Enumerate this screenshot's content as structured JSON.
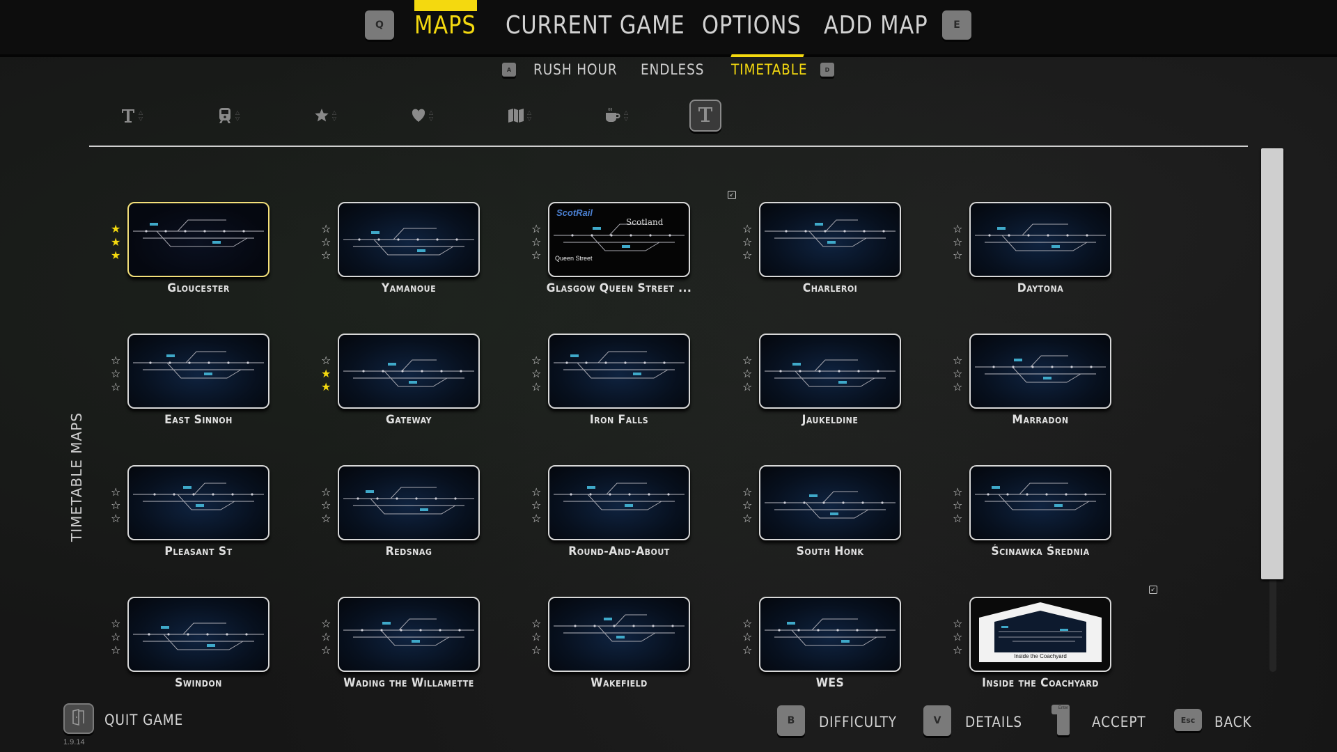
{
  "header": {
    "prev_key": "Q",
    "next_key": "E",
    "tabs": [
      {
        "label": "MAPS",
        "active": true
      },
      {
        "label": "CURRENT GAME",
        "active": false
      },
      {
        "label": "OPTIONS",
        "active": false
      },
      {
        "label": "ADD MAP",
        "active": false
      }
    ]
  },
  "subtabs": {
    "prev_key": "A",
    "next_key": "D",
    "items": [
      {
        "label": "RUSH HOUR",
        "active": false
      },
      {
        "label": "ENDLESS",
        "active": false
      },
      {
        "label": "TIMETABLE",
        "active": true
      }
    ]
  },
  "filters": [
    {
      "icon": "text-sort-icon",
      "label": "Name"
    },
    {
      "icon": "train-icon",
      "label": "Trains"
    },
    {
      "icon": "star-icon",
      "label": "Stars"
    },
    {
      "icon": "heart-icon",
      "label": "Favourites"
    },
    {
      "icon": "map-icon",
      "label": "Map"
    },
    {
      "icon": "coffee-icon",
      "label": "Casual"
    },
    {
      "icon": "text-icon",
      "label": "Timetable",
      "selected": true
    }
  ],
  "section_label": "TIMETABLE MAPS",
  "maps": [
    {
      "name": "Gloucester",
      "stars": 3,
      "selected": true,
      "custom": false
    },
    {
      "name": "Yamanoue",
      "stars": 0,
      "custom": false
    },
    {
      "name": "Glasgow Queen Street ...",
      "stars": 0,
      "custom": true,
      "thumb_text": [
        "ScotRail",
        "Scotland",
        "Queen Street"
      ]
    },
    {
      "name": "Charleroi",
      "stars": 0,
      "custom": false
    },
    {
      "name": "Daytona",
      "stars": 0,
      "custom": false
    },
    {
      "name": "East Sinnoh",
      "stars": 0,
      "custom": false
    },
    {
      "name": "Gateway",
      "stars": 2,
      "custom": false
    },
    {
      "name": "Iron Falls",
      "stars": 0,
      "custom": false
    },
    {
      "name": "Jaukeldine",
      "stars": 0,
      "custom": false
    },
    {
      "name": "Marradon",
      "stars": 0,
      "custom": false
    },
    {
      "name": "Pleasant St",
      "stars": 0,
      "custom": false
    },
    {
      "name": "Redsnag",
      "stars": 0,
      "custom": false
    },
    {
      "name": "Round-And-About",
      "stars": 0,
      "custom": false
    },
    {
      "name": "South Honk",
      "stars": 0,
      "custom": false
    },
    {
      "name": "Ścinawka Średnia",
      "stars": 0,
      "custom": false
    },
    {
      "name": "Swindon",
      "stars": 0,
      "custom": false
    },
    {
      "name": "Wading the Willamette",
      "stars": 0,
      "custom": false
    },
    {
      "name": "Wakefield",
      "stars": 0,
      "custom": false
    },
    {
      "name": "WES",
      "stars": 0,
      "custom": false
    },
    {
      "name": "Inside the Coachyard",
      "stars": 0,
      "custom": true,
      "thumb_text": [
        "Inside the Coachyard"
      ]
    }
  ],
  "scroll": {
    "position_fraction": 0.0,
    "visible_fraction": 0.82
  },
  "footer": {
    "quit_label": "QUIT GAME",
    "version": "1.9.14",
    "actions": [
      {
        "key": "B",
        "label": "DIFFICULTY"
      },
      {
        "key": "V",
        "label": "DETAILS"
      },
      {
        "key": "Enter",
        "label": "ACCEPT"
      },
      {
        "key": "Esc",
        "label": "BACK"
      }
    ]
  },
  "colors": {
    "accent": "#f4d90f",
    "text": "#d2d2d2",
    "key_bg": "#7a7a7a"
  }
}
